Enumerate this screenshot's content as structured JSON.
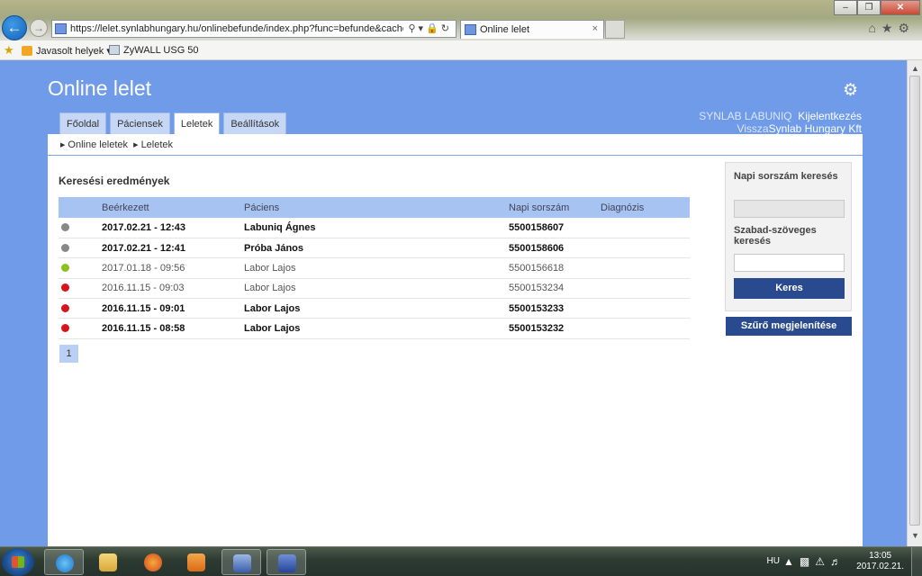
{
  "browser": {
    "url": "https://lelet.synlabhungary.hu/onlinebefunde/index.php?func=befunde&cache=delete",
    "tab_title": "Online lelet",
    "tab_close": "×",
    "favorites": {
      "suggested": "Javasolt helyek",
      "zywall": "ZyWALL USG 50"
    }
  },
  "site": {
    "title": "Online lelet",
    "user": "SYNLAB LABUNIQ",
    "logout": "Kijelentkezés",
    "back": "Vissza",
    "company": "Synlab Hungary Kft"
  },
  "nav": {
    "tabs": [
      {
        "label": "Főoldal",
        "active": false
      },
      {
        "label": "Páciensek",
        "active": false
      },
      {
        "label": "Leletek",
        "active": true
      },
      {
        "label": "Beállítások",
        "active": false
      }
    ]
  },
  "breadcrumb": {
    "items": [
      "Online leletek",
      "Leletek"
    ]
  },
  "results": {
    "title": "Keresési eredmények",
    "columns": [
      "Beérkezett",
      "Páciens",
      "Napi sorszám",
      "Diagnózis"
    ],
    "rows": [
      {
        "status_color": "#888888",
        "date": "2017.02.21 - 12:43",
        "patient": "Labuniq Ágnes",
        "number": "5500158607",
        "diagnosis": "",
        "bold": true
      },
      {
        "status_color": "#888888",
        "date": "2017.02.21 - 12:41",
        "patient": "Próba János",
        "number": "5500158606",
        "diagnosis": "",
        "bold": true
      },
      {
        "status_color": "#8cc21e",
        "date": "2017.01.18 - 09:56",
        "patient": "Labor Lajos",
        "number": "5500156618",
        "diagnosis": "",
        "bold": false
      },
      {
        "status_color": "#d7141e",
        "date": "2016.11.15 - 09:03",
        "patient": "Labor Lajos",
        "number": "5500153234",
        "diagnosis": "",
        "bold": false
      },
      {
        "status_color": "#d7141e",
        "date": "2016.11.15 - 09:01",
        "patient": "Labor Lajos",
        "number": "5500153233",
        "diagnosis": "",
        "bold": true
      },
      {
        "status_color": "#d7141e",
        "date": "2016.11.15 - 08:58",
        "patient": "Labor Lajos",
        "number": "5500153232",
        "diagnosis": "",
        "bold": true
      }
    ],
    "page": "1"
  },
  "search": {
    "daily_number_label": "Napi sorszám keresés",
    "daily_number_value": "",
    "freetext_label": "Szabad-szöveges keresés",
    "freetext_value": "",
    "search_button": "Keres",
    "filter_button": "Szűrő megjelenítése"
  },
  "taskbar": {
    "lang": "HU",
    "time": "13:05",
    "date": "2017.02.21."
  },
  "colors": {
    "page_bg": "#6f9be9",
    "header_row": "#a6c3f2",
    "button": "#2a4a8f",
    "status_grey": "#888888",
    "status_green": "#8cc21e",
    "status_red": "#d7141e"
  }
}
